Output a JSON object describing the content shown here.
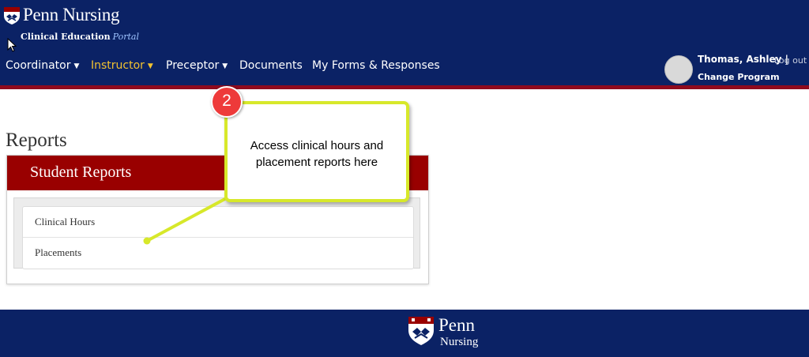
{
  "brand": {
    "title": "Penn Nursing",
    "subtitle": "Clinical Education",
    "subtitle_accent": "Portal"
  },
  "nav": {
    "items": [
      {
        "label": "Coordinator",
        "caret": "▼"
      },
      {
        "label": "Instructor",
        "caret": "▼"
      },
      {
        "label": "Preceptor",
        "caret": "▼"
      },
      {
        "label": "Documents"
      },
      {
        "label": "My Forms & Responses"
      }
    ]
  },
  "user": {
    "name": "Thomas, Ashley |",
    "logout": "Log out",
    "change_program": "Change Program"
  },
  "page": {
    "title": "Reports"
  },
  "panel": {
    "title": "Student Reports",
    "items": [
      {
        "label": "Clinical Hours"
      },
      {
        "label": "Placements"
      }
    ]
  },
  "callout": {
    "step": "2",
    "text_line1": "Access clinical hours and",
    "text_line2": "placement reports here",
    "border_color": "#d7e82a",
    "badge_color": "#ee3a3a"
  },
  "footer": {
    "penn": "Penn",
    "nursing": "Nursing"
  },
  "colors": {
    "header_bg": "#0b2265",
    "accent_red": "#990000",
    "active_nav": "#f2c230"
  }
}
